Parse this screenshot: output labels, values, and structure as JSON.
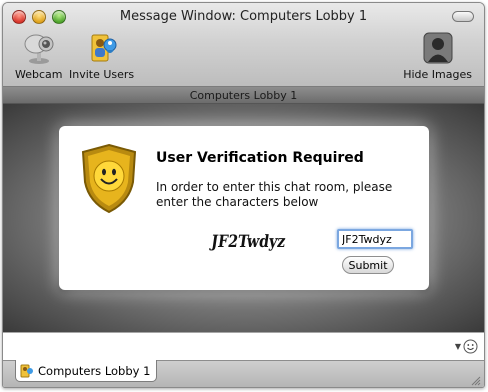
{
  "window": {
    "title": "Message Window: Computers Lobby 1"
  },
  "toolbar": {
    "webcam_label": "Webcam",
    "invite_label": "Invite Users",
    "hide_images_label": "Hide Images"
  },
  "room": {
    "header": "Computers Lobby 1"
  },
  "dialog": {
    "title": "User Verification Required",
    "message": "In order to enter this chat room, please enter the characters below",
    "captcha_text": "JF2Twdyz",
    "code_value": "JF2Twdyz",
    "submit_label": "Submit"
  },
  "tabs": [
    {
      "label": "Computers Lobby 1"
    }
  ],
  "icons": {
    "webcam": "webcam-icon",
    "invite": "invite-users-icon",
    "hide_images": "person-silhouette-icon",
    "shield": "shield-smiley-icon",
    "emoticon": "smiley-icon",
    "tab": "room-icon"
  },
  "colors": {
    "shield_gold": "#e7b41d",
    "focus_ring": "#7ba7e0"
  }
}
